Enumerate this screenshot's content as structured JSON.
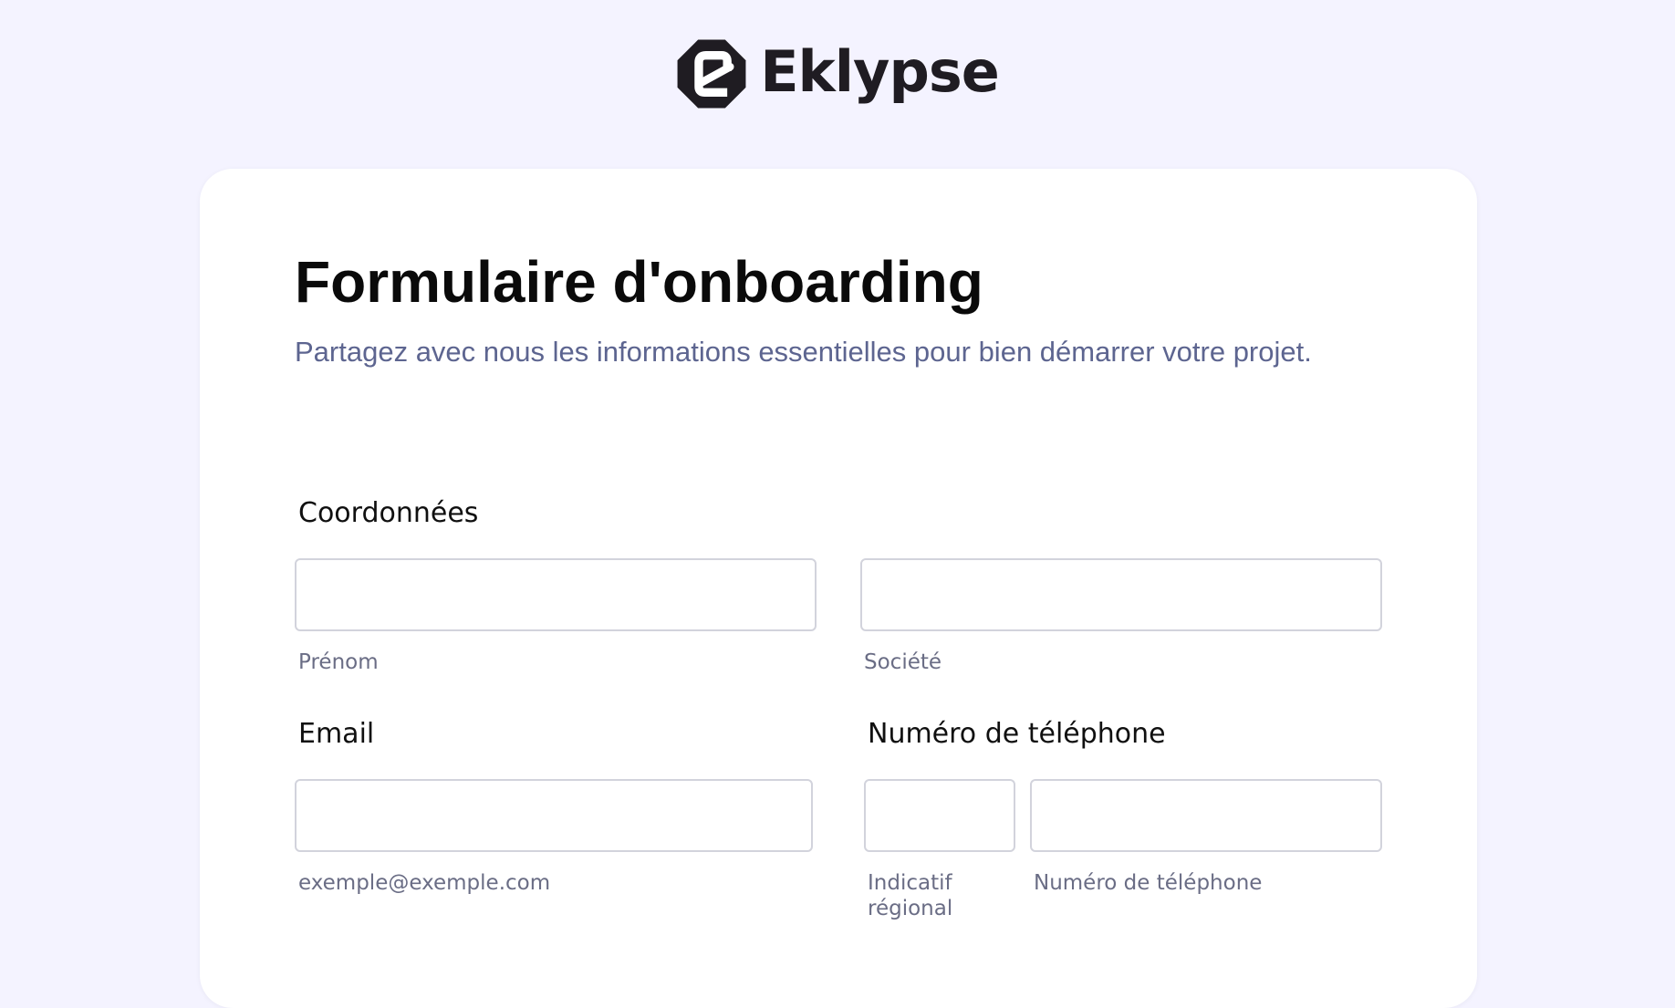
{
  "brand": {
    "name": "Eklypse",
    "logo_icon": "eklypse-logo-icon"
  },
  "form": {
    "title": "Formulaire d'onboarding",
    "subtitle": "Partagez avec nous les informations essentielles pour bien démarrer votre projet."
  },
  "sections": {
    "coordonnees": {
      "label": "Coordonnées",
      "first_name": {
        "value": "",
        "sublabel": "Prénom"
      },
      "company": {
        "value": "",
        "sublabel": "Société"
      }
    },
    "email": {
      "label": "Email",
      "value": "",
      "sublabel": "exemple@exemple.com"
    },
    "phone": {
      "label": "Numéro de téléphone",
      "area_code": {
        "value": "",
        "sublabel": "Indicatif régional"
      },
      "number": {
        "value": "",
        "sublabel": "Numéro de téléphone"
      }
    }
  },
  "colors": {
    "page_background": "#f4f3ff",
    "card_background": "#ffffff",
    "title": "#0a0a0a",
    "subtitle": "#5d6590",
    "sublabel": "#6a6d85",
    "input_border": "#d2d3dc",
    "brand": "#1f1c22"
  }
}
